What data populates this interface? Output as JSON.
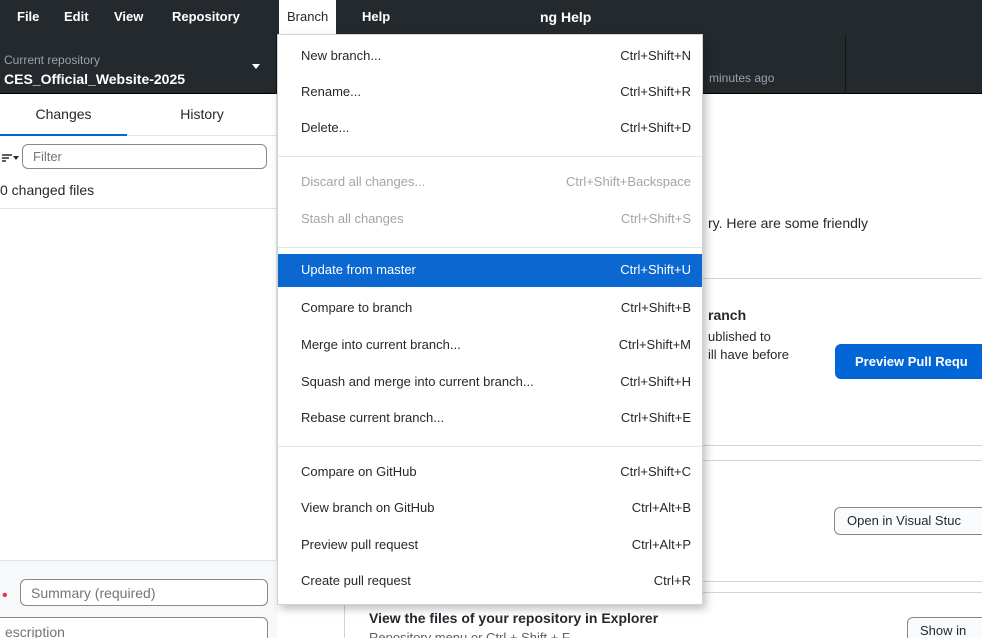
{
  "menubar": {
    "items": [
      "File",
      "Edit",
      "View",
      "Repository",
      "Branch",
      "Help"
    ],
    "window_title": "ng Help"
  },
  "toolbar": {
    "repo_label": "Current repository",
    "repo_name": "CES_Official_Website-2025",
    "fetch_subtitle": "minutes ago"
  },
  "sidebar": {
    "tab_changes": "Changes",
    "tab_history": "History",
    "filter_placeholder": "Filter",
    "changed_count": "0 changed files",
    "summary_placeholder": "Summary (required)",
    "description_placeholder": "escription"
  },
  "main": {
    "intro_text": "ry. Here are some friendly",
    "pr_title": "ranch",
    "pr_desc_1": "ublished to",
    "pr_desc_2": "ill have before",
    "pr_button": "Preview Pull Requ",
    "editor_button": "Open in Visual Stuc",
    "explorer_title": "View the files of your repository in Explorer",
    "explorer_sub": "Repository menu or Ctrl + Shift + F",
    "explorer_button": "Show in"
  },
  "branch_menu": {
    "groups": [
      [
        {
          "label": "New branch...",
          "shortcut": "Ctrl+Shift+N",
          "disabled": false
        },
        {
          "label": "Rename...",
          "shortcut": "Ctrl+Shift+R",
          "disabled": false
        },
        {
          "label": "Delete...",
          "shortcut": "Ctrl+Shift+D",
          "disabled": false
        }
      ],
      [
        {
          "label": "Discard all changes...",
          "shortcut": "Ctrl+Shift+Backspace",
          "disabled": true
        },
        {
          "label": "Stash all changes",
          "shortcut": "Ctrl+Shift+S",
          "disabled": true
        }
      ],
      [
        {
          "label": "Update from master",
          "shortcut": "Ctrl+Shift+U",
          "disabled": false,
          "highlighted": true
        },
        {
          "label": "Compare to branch",
          "shortcut": "Ctrl+Shift+B",
          "disabled": false
        },
        {
          "label": "Merge into current branch...",
          "shortcut": "Ctrl+Shift+M",
          "disabled": false
        },
        {
          "label": "Squash and merge into current branch...",
          "shortcut": "Ctrl+Shift+H",
          "disabled": false
        },
        {
          "label": "Rebase current branch...",
          "shortcut": "Ctrl+Shift+E",
          "disabled": false
        }
      ],
      [
        {
          "label": "Compare on GitHub",
          "shortcut": "Ctrl+Shift+C",
          "disabled": false
        },
        {
          "label": "View branch on GitHub",
          "shortcut": "Ctrl+Alt+B",
          "disabled": false
        },
        {
          "label": "Preview pull request",
          "shortcut": "Ctrl+Alt+P",
          "disabled": false
        },
        {
          "label": "Create pull request",
          "shortcut": "Ctrl+R",
          "disabled": false
        }
      ]
    ]
  },
  "colors": {
    "chrome_dark": "#24292e",
    "accent_blue": "#0366d6",
    "menu_highlight": "#0a68d0",
    "disabled_text": "#a0a5ab"
  }
}
